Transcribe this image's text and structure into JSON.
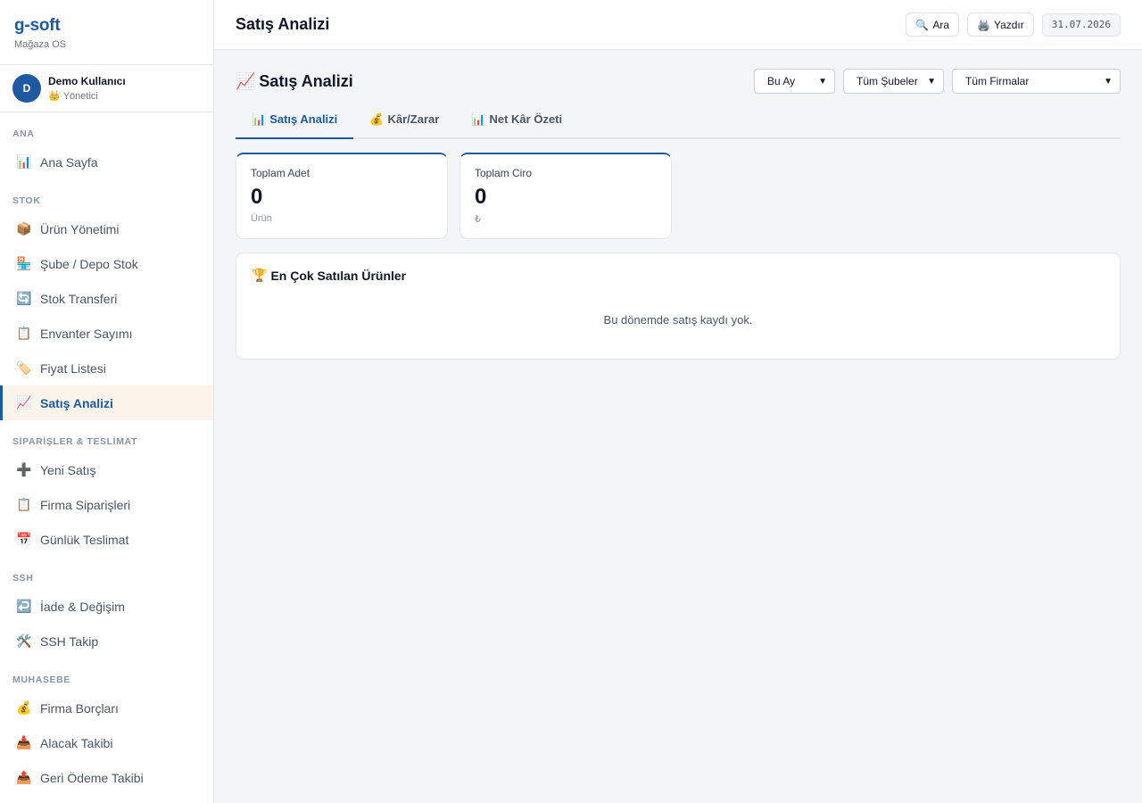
{
  "brand": {
    "name": "g-soft",
    "subtitle": "Mağaza OS"
  },
  "user": {
    "initial": "D",
    "name": "Demo Kullanıcı",
    "role_icon": "👑",
    "role": "Yönetici"
  },
  "sidebar": {
    "sections": [
      {
        "title": "ANA",
        "items": [
          {
            "icon": "📊",
            "label": "Ana Sayfa"
          }
        ]
      },
      {
        "title": "STOK",
        "items": [
          {
            "icon": "📦",
            "label": "Ürün Yönetimi"
          },
          {
            "icon": "🏪",
            "label": "Şube / Depo Stok"
          },
          {
            "icon": "🔄",
            "label": "Stok Transferi"
          },
          {
            "icon": "📋",
            "label": "Envanter Sayımı"
          },
          {
            "icon": "🏷️",
            "label": "Fiyat Listesi"
          },
          {
            "icon": "📈",
            "label": "Satış Analizi",
            "active": true
          }
        ]
      },
      {
        "title": "SİPARİŞLER & TESLİMAT",
        "items": [
          {
            "icon": "➕",
            "label": "Yeni Satış"
          },
          {
            "icon": "📋",
            "label": "Firma Siparişleri"
          },
          {
            "icon": "📅",
            "label": "Günlük Teslimat"
          }
        ]
      },
      {
        "title": "SSH",
        "items": [
          {
            "icon": "↩️",
            "label": "İade & Değişim"
          },
          {
            "icon": "🛠️",
            "label": "SSH Takip"
          }
        ]
      },
      {
        "title": "MUHASEBE",
        "items": [
          {
            "icon": "💰",
            "label": "Firma Borçları"
          },
          {
            "icon": "📥",
            "label": "Alacak Takibi"
          },
          {
            "icon": "📤",
            "label": "Geri Ödeme Takibi"
          }
        ]
      }
    ]
  },
  "header": {
    "title": "Satış Analizi",
    "search": {
      "icon": "🔍",
      "label": "Ara"
    },
    "print": {
      "icon": "🖨️",
      "label": "Yazdır"
    },
    "date": "31.07.2026"
  },
  "main": {
    "title_icon": "📈",
    "title": "Satış Analizi",
    "filters": {
      "period": "Bu Ay",
      "branch": "Tüm Şubeler",
      "company": "Tüm Firmalar"
    },
    "tabs": [
      {
        "icon": "📊",
        "label": "Satış Analizi",
        "active": true
      },
      {
        "icon": "💰",
        "label": "Kâr/Zarar"
      },
      {
        "icon": "📊",
        "label": "Net Kâr Özeti"
      }
    ],
    "stats": [
      {
        "label": "Toplam Adet",
        "value": "0",
        "unit": "Ürün"
      },
      {
        "label": "Toplam Ciro",
        "value": "0",
        "unit": "₺"
      }
    ],
    "top_products": {
      "title_icon": "🏆",
      "title": "En Çok Satılan Ürünler",
      "empty": "Bu dönemde satış kaydı yok."
    }
  },
  "colors": {
    "accent": "#1d5aa0",
    "active_bg": "#faf4ea",
    "page_bg": "#f3f5f8"
  }
}
